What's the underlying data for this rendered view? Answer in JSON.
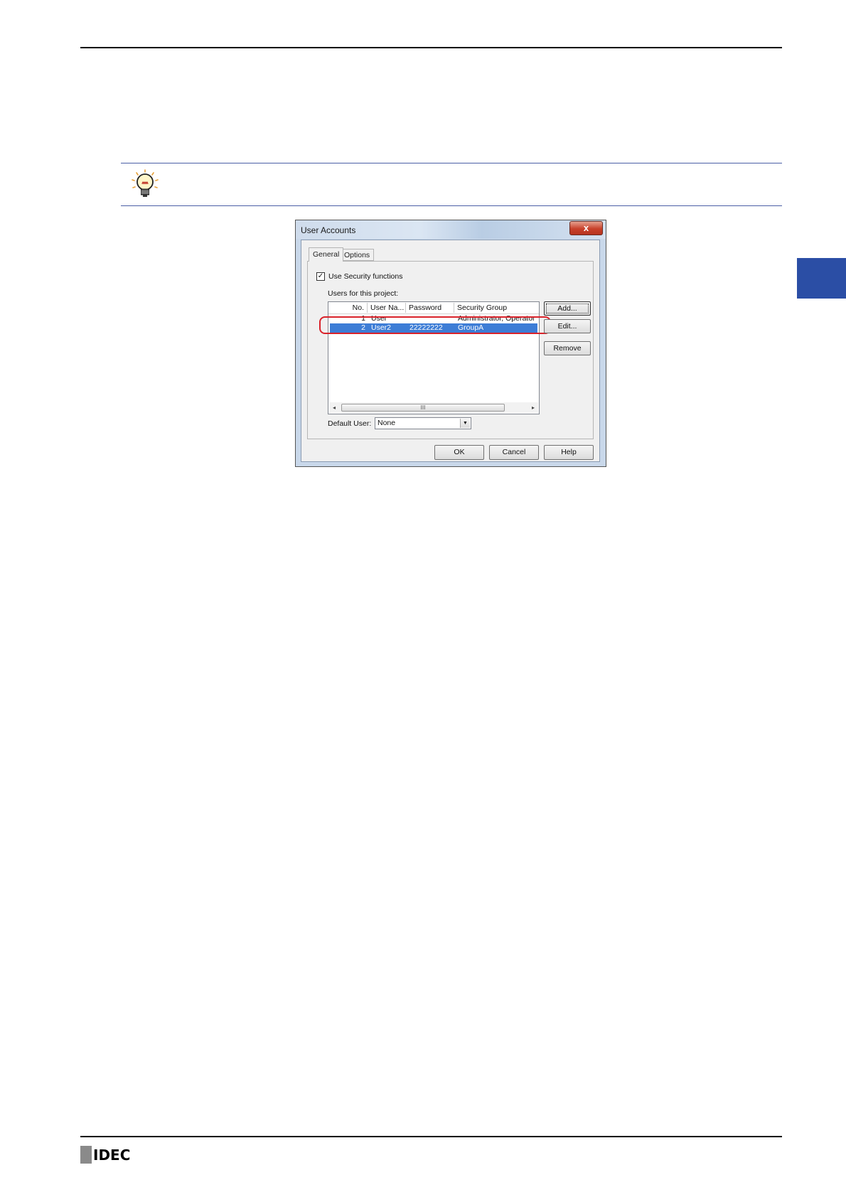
{
  "dialog": {
    "title": "User Accounts",
    "close_label": "x",
    "tabs": [
      "General",
      "Options"
    ],
    "use_security_label": "Use Security functions",
    "use_security_checked": true,
    "users_label": "Users for this project:",
    "columns": [
      "No.",
      "User Na...",
      "Password",
      "Security Group"
    ],
    "rows": [
      {
        "no": "1",
        "user": "User",
        "password": "",
        "group": "Administrator, Operator"
      },
      {
        "no": "2",
        "user": "User2",
        "password": "22222222",
        "group": "GroupA"
      }
    ],
    "selected_row": 2,
    "scroll_thumb_glyph": "III",
    "buttons": {
      "add": "Add...",
      "edit": "Edit...",
      "remove": "Remove",
      "ok": "OK",
      "cancel": "Cancel",
      "help": "Help"
    },
    "default_user_label": "Default User:",
    "default_user_value": "None"
  },
  "footer": {
    "logo_text": "IDEC"
  },
  "colors": {
    "accent_blue": "#2b4ea5",
    "highlight_red": "#d9222a",
    "selection": "#3d7dd6"
  }
}
